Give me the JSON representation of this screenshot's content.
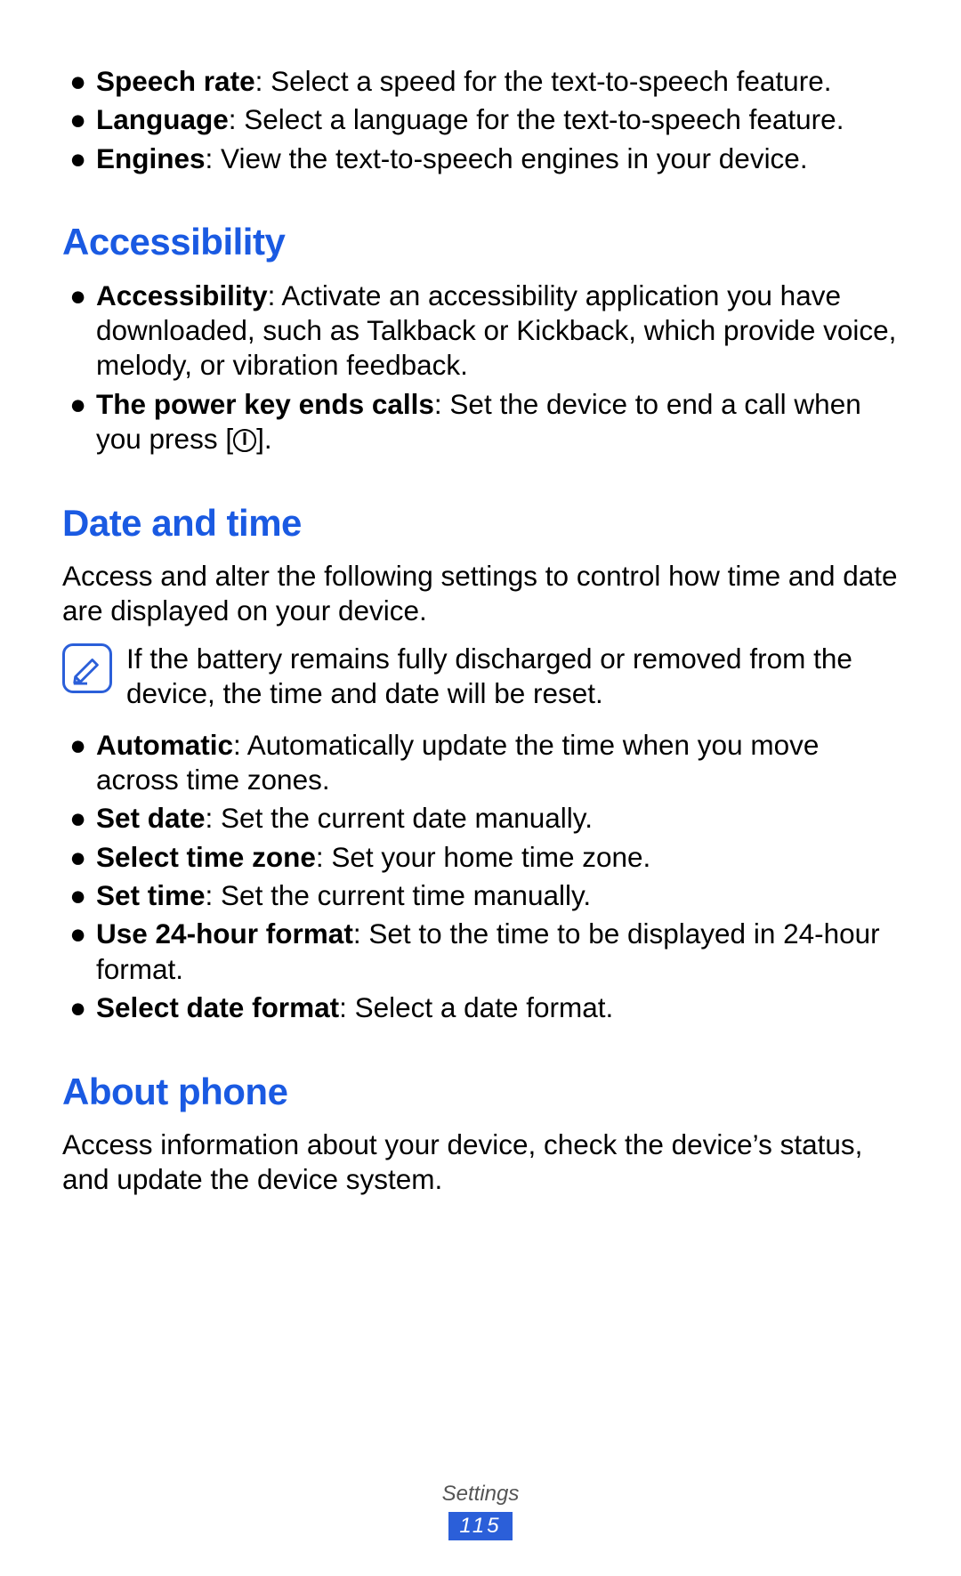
{
  "top_bullets": [
    {
      "term": "Speech rate",
      "desc": ": Select a speed for the text-to-speech feature."
    },
    {
      "term": "Language",
      "desc": ": Select a language for the text-to-speech feature."
    },
    {
      "term": "Engines",
      "desc": ": View the text-to-speech engines in your device."
    }
  ],
  "accessibility": {
    "heading": "Accessibility",
    "bullets": [
      {
        "term": "Accessibility",
        "desc": ": Activate an accessibility application you have downloaded, such as Talkback or Kickback, which provide voice, melody, or vibration feedback."
      },
      {
        "term": "The power key ends calls",
        "desc_pre": ": Set the device to end a call when you press [",
        "desc_post": "]."
      }
    ]
  },
  "datetime": {
    "heading": "Date and time",
    "intro": "Access and alter the following settings to control how time and date are displayed on your device.",
    "note": "If the battery remains fully discharged or removed from the device, the time and date will be reset.",
    "bullets": [
      {
        "term": "Automatic",
        "desc": ": Automatically update the time when you move across time zones."
      },
      {
        "term": "Set date",
        "desc": ": Set the current date manually."
      },
      {
        "term": "Select time zone",
        "desc": ": Set your home time zone."
      },
      {
        "term": "Set time",
        "desc": ": Set the current time manually."
      },
      {
        "term": "Use 24-hour format",
        "desc": ": Set to the time to be displayed in 24-hour format."
      },
      {
        "term": "Select date format",
        "desc": ": Select a date format."
      }
    ]
  },
  "about": {
    "heading": "About phone",
    "intro": "Access information about your device, check the device’s status, and update the device system."
  },
  "footer": {
    "section": "Settings",
    "page": "115"
  },
  "bullet_char": "●"
}
